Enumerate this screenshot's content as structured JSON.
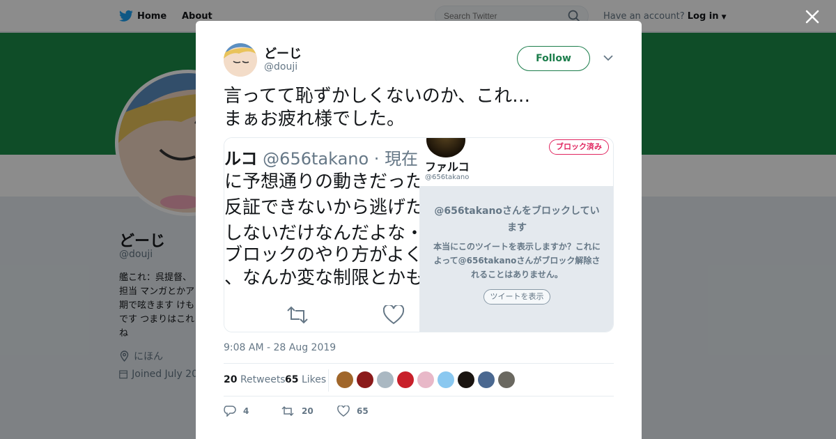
{
  "topbar": {
    "home_label": "Home",
    "about_label": "About",
    "search_placeholder": "Search Twitter",
    "account_prompt": "Have an account?",
    "login_label": "Log in"
  },
  "profile_bg": {
    "name": "どーじ",
    "handle": "@douji",
    "bio_lines": [
      "艦これ：呉提督、",
      "担当 マンガとかア",
      "期で呟きます けも",
      "です つまりはこれ",
      "ね"
    ],
    "location": "にほん",
    "joined": "Joined July 20"
  },
  "tweet": {
    "name": "どーじ",
    "handle": "@douji",
    "follow_label": "Follow",
    "text": "言ってて恥ずかしくないのか、これ…\nまぁお疲れ様でした。",
    "timestamp": "9:08 AM - 28 Aug 2019",
    "retweets_count": "20",
    "retweets_label": "Retweets",
    "likes_count": "65",
    "likes_label": "Likes",
    "reply_count": "4",
    "retweet_action_count": "20",
    "like_action_count": "65"
  },
  "media": {
    "left": {
      "name": "ルコ",
      "handle": "@656takano · 現在",
      "lines": [
        "に予想通りの動きだった",
        "反証できないから逃げた",
        "しないだけなんだよな・",
        "ブロックのやり方がよく",
        "、なんか変な制限とかも"
      ]
    },
    "right": {
      "name": "ファルコ",
      "handle": "@656takano",
      "badge": "ブロック済み",
      "title": "@656takanoさんをブロックしています",
      "body": "本当にこのツイートを表示しますか？これによって@656takanoさんがブロック解除されることはありません。",
      "button": "ツイートを表示"
    }
  },
  "colors": {
    "banner": "#1d8c4a",
    "follow_accent": "#1b7d4b",
    "blocked_badge": "#e0245e",
    "twitter_blue": "#1da1f2"
  },
  "likers": [
    {
      "color": "#a0662a"
    },
    {
      "color": "#8b1a1a"
    },
    {
      "color": "#aab8c2"
    },
    {
      "color": "#c8202a"
    },
    {
      "color": "#e8b8c8"
    },
    {
      "color": "#8ac8f0"
    },
    {
      "color": "#1a1410"
    },
    {
      "color": "#4a6890"
    },
    {
      "color": "#6a6860"
    }
  ]
}
